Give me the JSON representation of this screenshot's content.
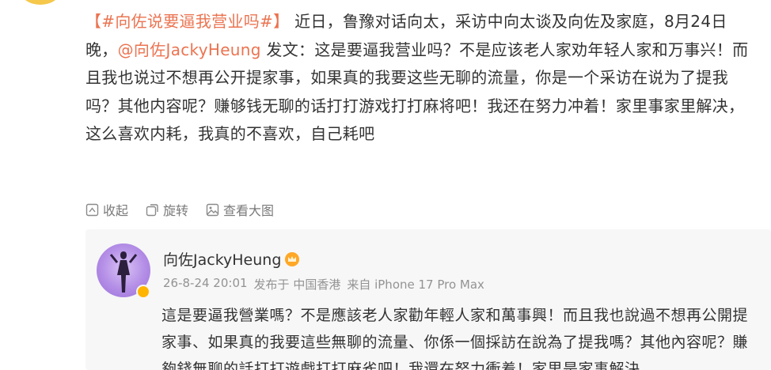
{
  "post": {
    "hashtag": "【#向佐说要逼我营业吗#】",
    "intro": " 近日，鲁豫对话向太，采访中向太谈及向佐及家庭，8月24日晚，",
    "mention": "@向佐JackyHeung",
    "body": " 发文：这是要逼我营业吗？不是应该老人家劝年轻人家和万事兴！而且我也说过不想再公开提家事，如果真的我要这些无聊的流量，你是一个采访在说为了提我吗？其他内容呢？赚够钱无聊的话打打游戏打打麻将吧！我还在努力冲着！家里事家里解决，这么喜欢内耗，我真的不喜欢，自己耗吧"
  },
  "actions": {
    "collapse": "收起",
    "repost": "旋转",
    "view_large": "查看大图"
  },
  "repost": {
    "author": "向佐JackyHeung",
    "time": "26-8-24 20:01",
    "published_from": "发布于 中国香港",
    "device": "来自 iPhone 17 Pro Max",
    "text": "這是要逼我營業嗎？不是應該老人家勸年輕人家和萬事興！而且我也說過不想再公開提家事、如果真的我要這些無聊的流量、你係一個採訪在說為了提我嗎？其他內容呢？賺夠錢無聊的話打打遊戲打打麻雀吧！我還在努力衝着！家里是家事解決"
  },
  "colors": {
    "link": "#eb7350",
    "meta": "#939393",
    "card_bg": "#f7f7f7"
  }
}
